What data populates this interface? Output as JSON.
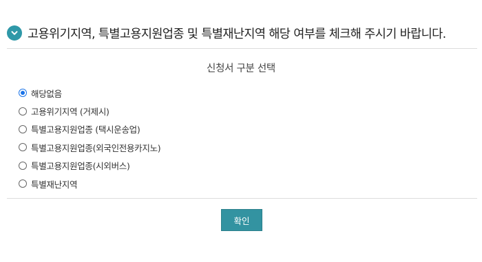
{
  "header": {
    "icon": "chevron-down-circle-icon",
    "icon_color": "#2f98a8",
    "title": "고용위기지역, 특별고용지원업종 및 특별재난지역 해당 여부를 체크해 주시기 바랍니다."
  },
  "section": {
    "title": "신청서 구분 선택"
  },
  "options": [
    {
      "label": "해당없음",
      "checked": true
    },
    {
      "label": "고용위기지역 (거제시)",
      "checked": false
    },
    {
      "label": "특별고용지원업종 (택시운송업)",
      "checked": false
    },
    {
      "label": "특별고용지원업종(외국인전용카지노)",
      "checked": false
    },
    {
      "label": "특별고용지원업종(시외버스)",
      "checked": false
    },
    {
      "label": "특별재난지역",
      "checked": false
    }
  ],
  "confirm": {
    "label": "확인",
    "color": "#3393a1"
  }
}
